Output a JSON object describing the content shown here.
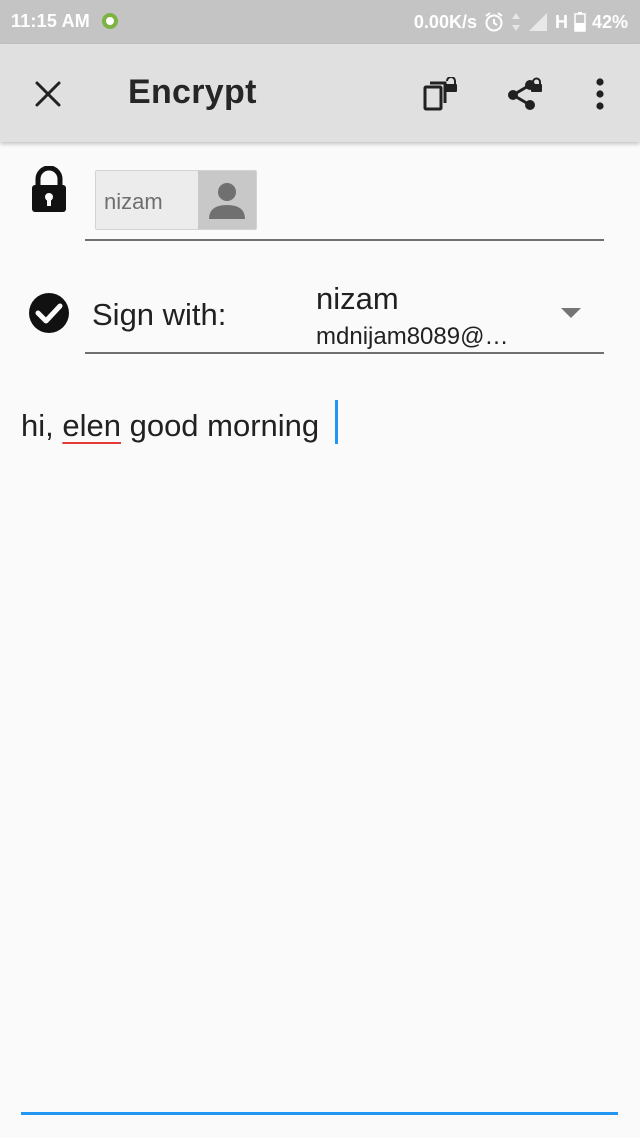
{
  "status_bar": {
    "time": "11:15 AM",
    "network_speed": "0.00K/s",
    "network_type": "H",
    "battery": "42%"
  },
  "app_bar": {
    "title": "Encrypt",
    "close_icon": "close-icon",
    "encrypt_files_icon": "encrypted-copy-icon",
    "share_icon": "share-locked-icon",
    "overflow_icon": "more-vertical-icon"
  },
  "recipients": {
    "chip_label": "nizam"
  },
  "signature": {
    "label": "Sign with:",
    "name": "nizam",
    "email": "mdnijam8089@…"
  },
  "message": {
    "before_misspelled": "hi, ",
    "misspelled": "elen",
    "after_misspelled": " good morning"
  },
  "colors": {
    "accent": "#2196f3",
    "app_bar": "#e0e0e0",
    "status_bar": "#c4c4c4",
    "spell_error": "#e53935"
  }
}
